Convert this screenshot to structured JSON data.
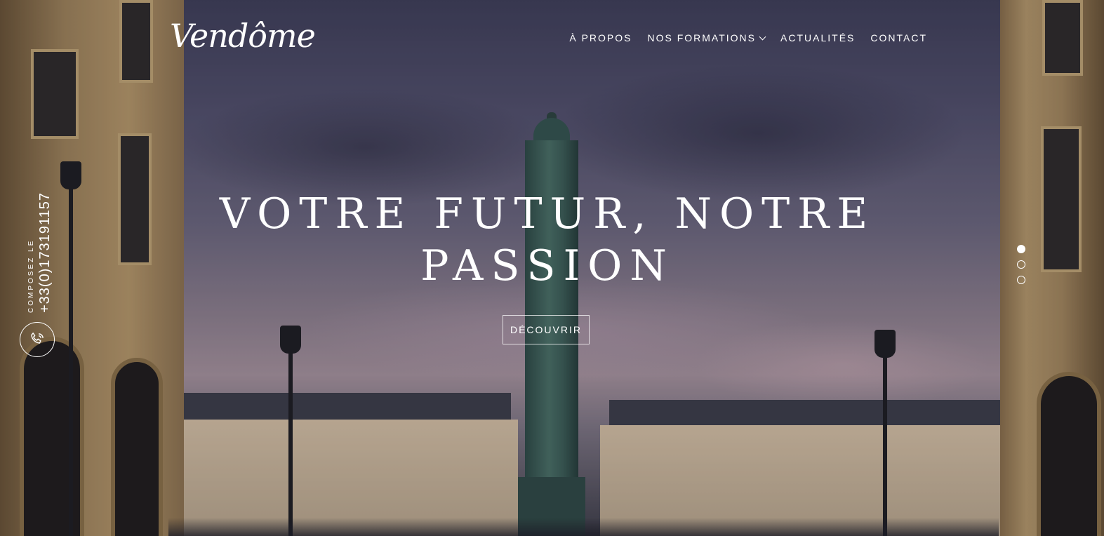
{
  "brand": {
    "logo_text": "Vendôme"
  },
  "nav": {
    "items": [
      {
        "label": "À PROPOS"
      },
      {
        "label": "NOS FORMATIONS",
        "has_dropdown": true
      },
      {
        "label": "ACTUALITÉS"
      },
      {
        "label": "CONTACT"
      }
    ]
  },
  "hero": {
    "title_line1": "VOTRE FUTUR, NOTRE",
    "title_line2": "PASSION",
    "cta_label": "DÉCOUVRIR"
  },
  "contact": {
    "label": "COMPOSEZ LE",
    "phone": "+33(0)173191157",
    "icon": "phone-icon"
  },
  "slider": {
    "dot_count": 3,
    "active_index": 0
  }
}
